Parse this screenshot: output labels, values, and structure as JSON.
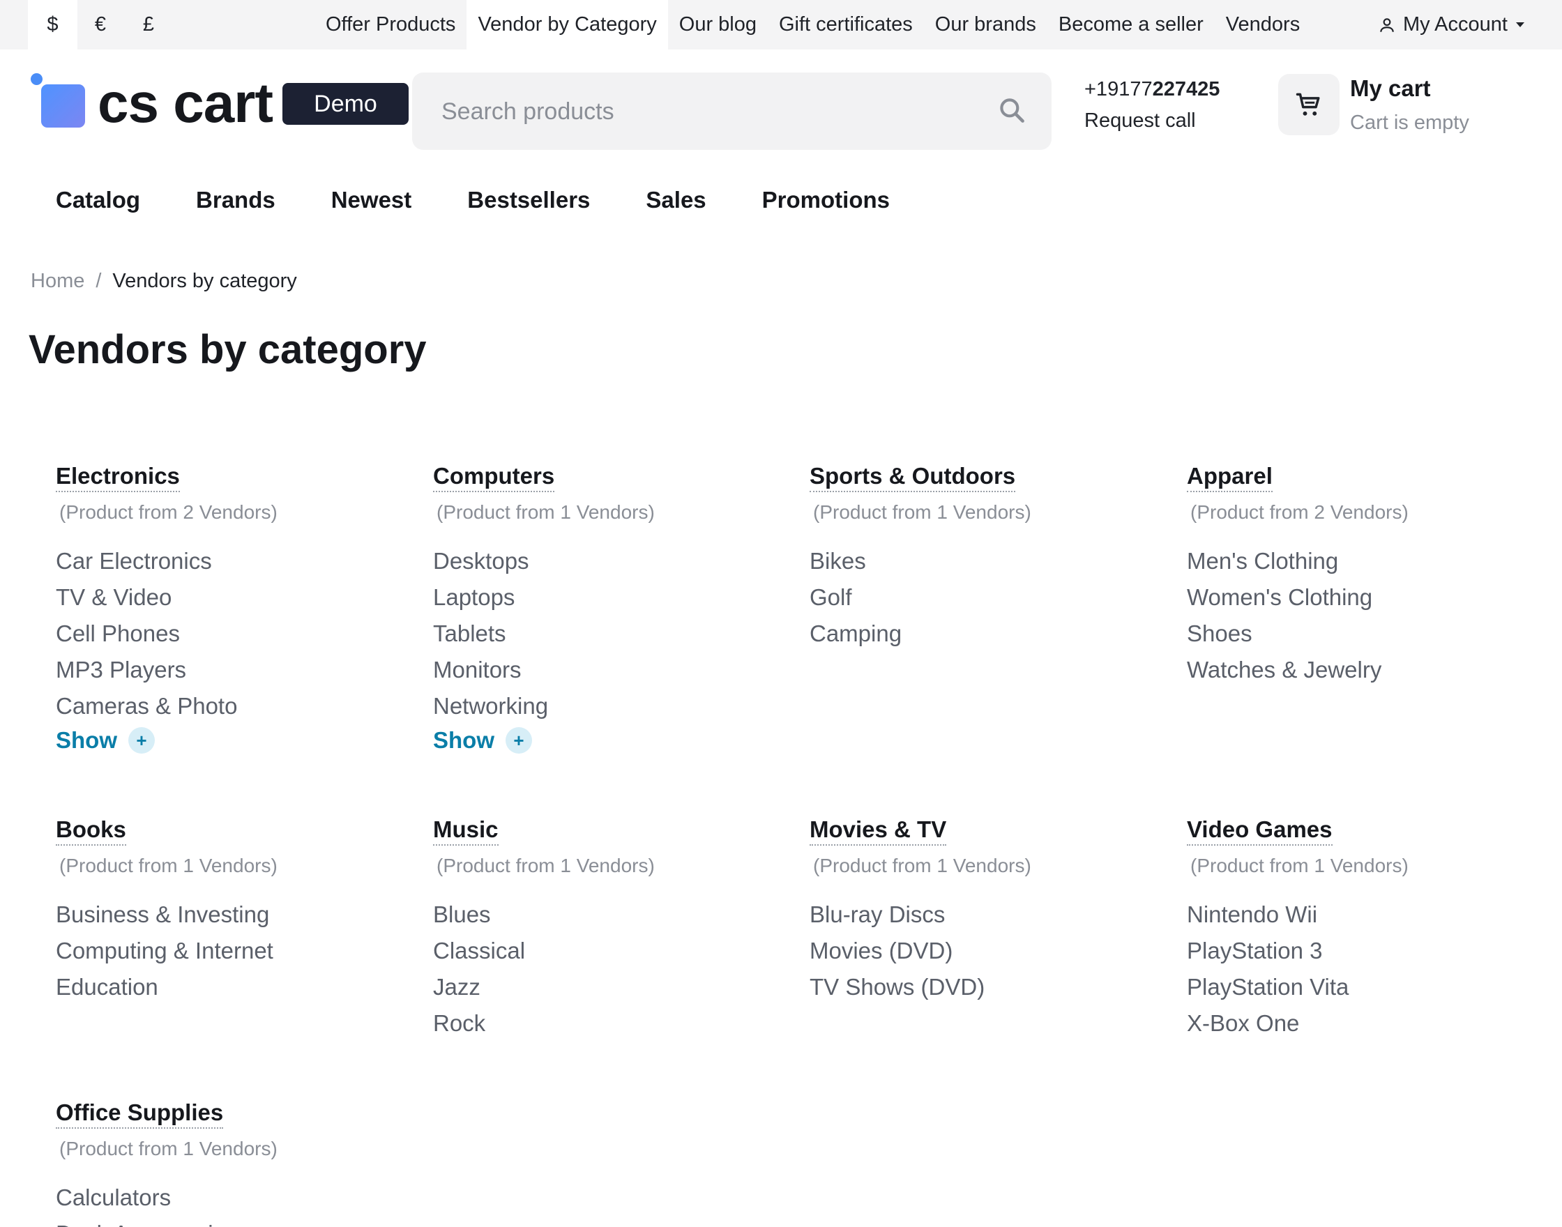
{
  "topbar": {
    "currencies": [
      {
        "symbol": "$",
        "active": true
      },
      {
        "symbol": "€",
        "active": false
      },
      {
        "symbol": "£",
        "active": false
      }
    ],
    "links": [
      {
        "label": "Offer Products",
        "active": false
      },
      {
        "label": "Vendor by Category",
        "active": true
      },
      {
        "label": "Our blog",
        "active": false
      },
      {
        "label": "Gift certificates",
        "active": false
      },
      {
        "label": "Our brands",
        "active": false
      },
      {
        "label": "Become a seller",
        "active": false
      },
      {
        "label": "Vendors",
        "active": false
      }
    ],
    "account_label": "My Account",
    "account_icon": "user-icon"
  },
  "header": {
    "logo_text": "cs cart",
    "logo_badge": "Demo",
    "search_placeholder": "Search products",
    "search_icon": "search-icon",
    "phone_prefix": "+19177",
    "phone_suffix": "227425",
    "request_call": "Request call",
    "cart_title": "My cart",
    "cart_status": "Cart is empty",
    "cart_icon": "cart-icon"
  },
  "main_nav": [
    "Catalog",
    "Brands",
    "Newest",
    "Bestsellers",
    "Sales",
    "Promotions"
  ],
  "breadcrumb": {
    "home": "Home",
    "separator": "/",
    "current": "Vendors by category"
  },
  "page_title": "Vendors by category",
  "categories": [
    {
      "title": "Electronics",
      "vendors": "(Product from 2 Vendors)",
      "items": [
        "Car Electronics",
        "TV & Video",
        "Cell Phones",
        "MP3 Players",
        "Cameras & Photo"
      ],
      "show": "Show"
    },
    {
      "title": "Computers",
      "vendors": "(Product from 1 Vendors)",
      "items": [
        "Desktops",
        "Laptops",
        "Tablets",
        "Monitors",
        "Networking"
      ],
      "show": "Show"
    },
    {
      "title": "Sports & Outdoors",
      "vendors": "(Product from 1 Vendors)",
      "items": [
        "Bikes",
        "Golf",
        "Camping"
      ]
    },
    {
      "title": "Apparel",
      "vendors": "(Product from 2 Vendors)",
      "items": [
        "Men's Clothing",
        "Women's Clothing",
        "Shoes",
        "Watches & Jewelry"
      ]
    },
    {
      "title": "Books",
      "vendors": "(Product from 1 Vendors)",
      "items": [
        "Business & Investing",
        "Computing & Internet",
        "Education"
      ]
    },
    {
      "title": "Music",
      "vendors": "(Product from 1 Vendors)",
      "items": [
        "Blues",
        "Classical",
        "Jazz",
        "Rock"
      ]
    },
    {
      "title": "Movies & TV",
      "vendors": "(Product from 1 Vendors)",
      "items": [
        "Blu-ray Discs",
        "Movies (DVD)",
        "TV Shows (DVD)"
      ]
    },
    {
      "title": "Video Games",
      "vendors": "(Product from 1 Vendors)",
      "items": [
        "Nintendo Wii",
        "PlayStation 3",
        "PlayStation Vita",
        "X-Box One"
      ]
    },
    {
      "title": "Office Supplies",
      "vendors": "(Product from 1 Vendors)",
      "items": [
        "Calculators",
        "Desk Accessories"
      ]
    }
  ],
  "show_plus": "+",
  "colors": {
    "accent": "#0a7ea8",
    "logo_blue": "#4f93ff",
    "badge_bg": "#1c2133",
    "muted": "#8a8e96"
  }
}
